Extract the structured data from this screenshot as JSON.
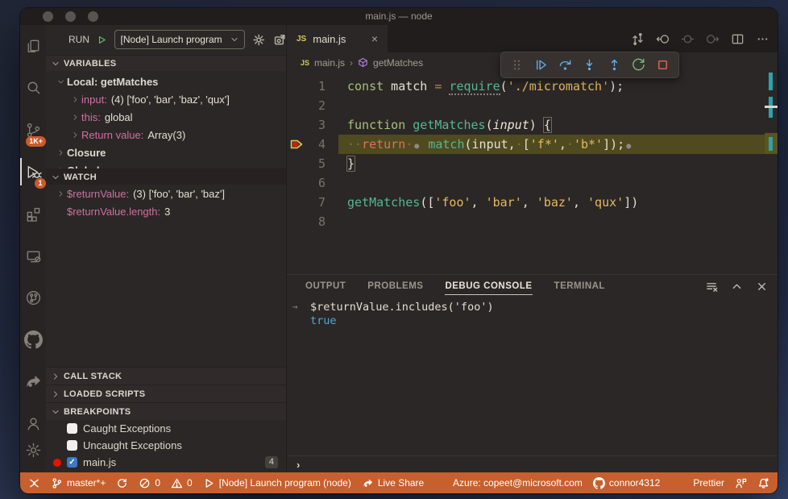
{
  "window": {
    "title": "main.js — node",
    "traffic_lights": [
      "close",
      "minimize",
      "zoom"
    ]
  },
  "activity_bar": {
    "items": [
      {
        "name": "explorer"
      },
      {
        "name": "search"
      },
      {
        "name": "source-control",
        "badge": "1K+"
      },
      {
        "name": "run-debug",
        "badge": "1",
        "active": true
      },
      {
        "name": "extensions"
      },
      {
        "name": "remote-explorer"
      },
      {
        "name": "pull-requests"
      },
      {
        "name": "github"
      },
      {
        "name": "live-share"
      },
      {
        "name": "accounts"
      }
    ],
    "bottom_item": {
      "name": "settings"
    }
  },
  "run_bar": {
    "run_label": "RUN",
    "config_label": "[Node] Launch program",
    "actions": [
      "configure",
      "open-debug-console"
    ]
  },
  "variables": {
    "header": "VARIABLES",
    "rows": [
      {
        "indent": 1,
        "arrow": "down",
        "label": "Local: getMatches"
      },
      {
        "indent": 2,
        "arrow": "right",
        "name": "input:",
        "value": "(4) ['foo', 'bar', 'baz', 'qux']"
      },
      {
        "indent": 2,
        "arrow": "right",
        "name": "this:",
        "value": "global"
      },
      {
        "indent": 2,
        "arrow": "right",
        "name": "Return value:",
        "value": "Array(3)"
      },
      {
        "indent": 1,
        "arrow": "right",
        "label": "Closure"
      },
      {
        "indent": 1,
        "arrow": "right",
        "label": "Global"
      }
    ]
  },
  "watch": {
    "header": "WATCH",
    "rows": [
      {
        "indent": 1,
        "arrow": "right",
        "name": "$returnValue:",
        "value": "(3) ['foo', 'bar', 'baz']"
      },
      {
        "indent": 1,
        "arrow": "none",
        "name": "$returnValue.length:",
        "value": "3"
      }
    ]
  },
  "collapsed_sections": [
    {
      "header": "CALL STACK"
    },
    {
      "header": "LOADED SCRIPTS"
    }
  ],
  "breakpoints": {
    "header": "BREAKPOINTS",
    "items": [
      {
        "label": "Caught Exceptions",
        "checked": false
      },
      {
        "label": "Uncaught Exceptions",
        "checked": false
      },
      {
        "label": "main.js",
        "checked": true,
        "dot": true,
        "badge": "4"
      }
    ]
  },
  "editor": {
    "tab": {
      "icon": "JS",
      "label": "main.js",
      "close": "×"
    },
    "actions": [
      "open-changes",
      "navigate-back",
      "navigate-dim",
      "navigate-forward",
      "split-editor",
      "more-actions"
    ],
    "breadcrumb": {
      "file": "main.js",
      "symbol": "getMatches",
      "separator": "›"
    },
    "debug_toolbar": [
      "gripper",
      "continue",
      "step-over",
      "step-into",
      "step-out",
      "restart",
      "stop"
    ],
    "lines": [
      {
        "n": "1",
        "tokens": [
          [
            "kw",
            "const"
          ],
          [
            "pl",
            " match "
          ],
          [
            "op",
            "="
          ],
          [
            "pl",
            " "
          ],
          [
            "fnu",
            "require"
          ],
          [
            "pl",
            "("
          ],
          [
            "str",
            "'./micromatch'"
          ],
          [
            "pl",
            ");"
          ]
        ]
      },
      {
        "n": "2",
        "tokens": []
      },
      {
        "n": "3",
        "tokens": [
          [
            "kw",
            "function"
          ],
          [
            "pl",
            " "
          ],
          [
            "fn",
            "getMatches"
          ],
          [
            "pl",
            "("
          ],
          [
            "param",
            "input"
          ],
          [
            "pl",
            ") "
          ],
          [
            "box",
            "{"
          ]
        ]
      },
      {
        "n": "4",
        "current": true,
        "tokens": [
          [
            "ws",
            "··"
          ],
          [
            "op",
            "return"
          ],
          [
            "ws",
            "·"
          ],
          [
            "bp",
            "●"
          ],
          [
            "pl",
            " "
          ],
          [
            "fn",
            "match"
          ],
          [
            "pl",
            "(input,"
          ],
          [
            "ws",
            "·"
          ],
          [
            "pl",
            "["
          ],
          [
            "str",
            "'f*'"
          ],
          [
            "pl",
            ","
          ],
          [
            "ws",
            "·"
          ],
          [
            "str",
            "'b*'"
          ],
          [
            "pl",
            "]);"
          ],
          [
            "bp",
            "●"
          ]
        ]
      },
      {
        "n": "5",
        "tokens": [
          [
            "box",
            "}"
          ]
        ]
      },
      {
        "n": "6",
        "tokens": []
      },
      {
        "n": "7",
        "tokens": [
          [
            "fn",
            "getMatches"
          ],
          [
            "pl",
            "(["
          ],
          [
            "str",
            "'foo'"
          ],
          [
            "pl",
            ", "
          ],
          [
            "str",
            "'bar'"
          ],
          [
            "pl",
            ", "
          ],
          [
            "str",
            "'baz'"
          ],
          [
            "pl",
            ", "
          ],
          [
            "str",
            "'qux'"
          ],
          [
            "pl",
            "])"
          ]
        ]
      },
      {
        "n": "8",
        "tokens": []
      }
    ]
  },
  "panel": {
    "tabs": [
      {
        "label": "OUTPUT"
      },
      {
        "label": "PROBLEMS"
      },
      {
        "label": "DEBUG CONSOLE",
        "active": true
      },
      {
        "label": "TERMINAL"
      }
    ],
    "actions": [
      "clear-console",
      "maximize-panel",
      "close-panel"
    ],
    "entries": [
      {
        "type": "input",
        "arrow": "→",
        "text": "$returnValue.includes('foo')"
      },
      {
        "type": "result",
        "arrow": "",
        "text": "true"
      }
    ],
    "prompt": "›"
  },
  "status_bar": {
    "left": [
      {
        "icon": "remote",
        "label": ""
      },
      {
        "icon": "branch",
        "label": "master*+"
      },
      {
        "icon": "sync",
        "label": ""
      },
      {
        "icon": "error",
        "label": "0"
      },
      {
        "icon": "warning",
        "label": "0"
      },
      {
        "icon": "play",
        "label": "[Node] Launch program (node)"
      },
      {
        "icon": "liveshare",
        "label": "Live Share"
      }
    ],
    "right": [
      {
        "icon": "",
        "label": "Azure: copeet@microsoft.com"
      },
      {
        "icon": "github",
        "label": "connor4312"
      },
      {
        "icon": "",
        "label": "Prettier",
        "spacer": true
      },
      {
        "icon": "feedback",
        "label": ""
      },
      {
        "icon": "bell",
        "label": ""
      }
    ]
  },
  "colors": {
    "status_bar": "#c7602e",
    "badge": "#cc5a2b",
    "keyword": "#a6c178",
    "control_keyword": "#e2705a",
    "function_name": "#54b892",
    "string": "#e6b960",
    "variable_name": "#d06fa4",
    "console_result": "#4fa8d8",
    "debug_blue": "#5fb2f2",
    "debug_green": "#71c175",
    "debug_red": "#ef6a5e",
    "current_line": "#4f4a20",
    "ruler_mark": "#2ba3ad"
  }
}
